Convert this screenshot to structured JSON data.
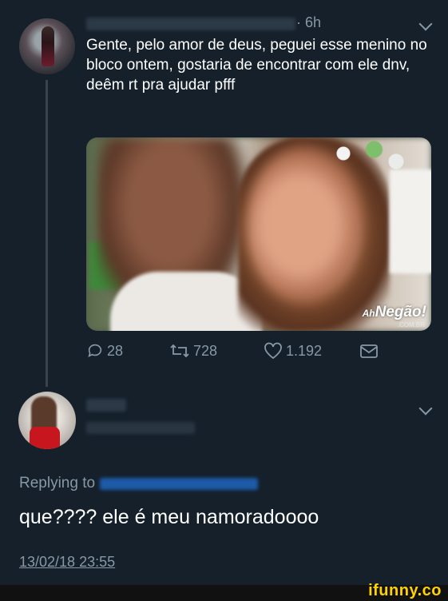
{
  "tweet": {
    "time": "· 6h",
    "text": "Gente, pelo amor de deus, peguei esse menino no bloco ontem, gostaria de encontrar com ele dnv, deêm rt pra ajudar pfff",
    "media_watermark": "Negão!",
    "media_watermark_prefix": "Ah",
    "media_watermark_sub": ".COM.BR",
    "actions": {
      "reply_count": "28",
      "retweet_count": "728",
      "like_count": "1.192"
    }
  },
  "reply": {
    "replying_to_label": "Replying to",
    "text": "que???? ele é meu namoradoooo",
    "timestamp": "13/02/18 23:55"
  },
  "footer": {
    "brand": "ifunny.co",
    "brand_color": "#ffd200"
  },
  "icons": [
    "reply-icon",
    "retweet-icon",
    "like-icon",
    "message-icon",
    "chevron-down-icon"
  ]
}
